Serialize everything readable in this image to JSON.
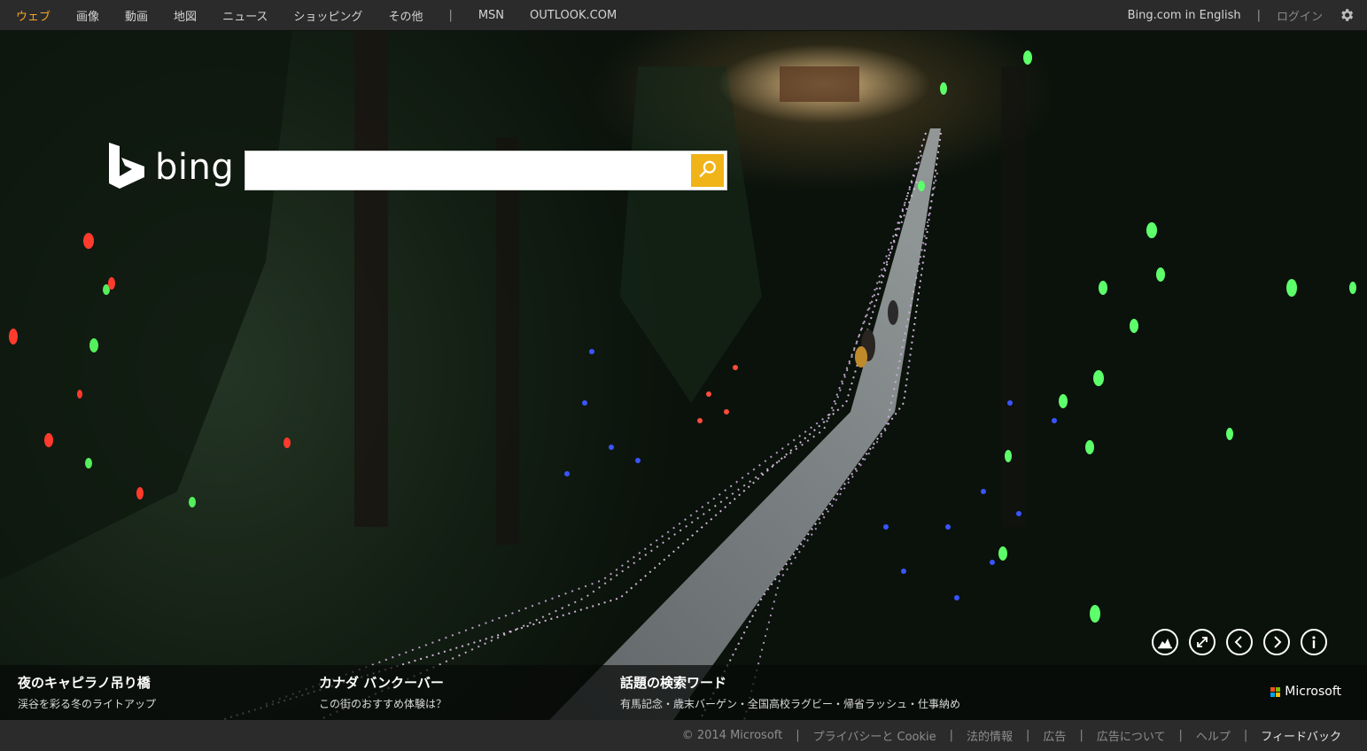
{
  "topnav": {
    "items": [
      {
        "label": "ウェブ",
        "active": true
      },
      {
        "label": "画像",
        "active": false
      },
      {
        "label": "動画",
        "active": false
      },
      {
        "label": "地図",
        "active": false
      },
      {
        "label": "ニュース",
        "active": false
      },
      {
        "label": "ショッピング",
        "active": false
      },
      {
        "label": "その他",
        "active": false
      }
    ],
    "separator": "|",
    "extra_links": [
      "MSN",
      "OUTLOOK.COM"
    ],
    "right": {
      "english_link": "Bing.com in English",
      "separator": "|",
      "login": "ログイン",
      "settings_icon": "gear-icon"
    }
  },
  "logo": {
    "word": "bing",
    "icon": "bing-b-icon"
  },
  "search": {
    "value": "",
    "placeholder": "",
    "button_icon": "search-icon",
    "button_color": "#f0b418"
  },
  "controls": [
    "map-pin-icon",
    "fullscreen-icon",
    "previous-icon",
    "next-icon",
    "info-icon"
  ],
  "captions": [
    {
      "title": "夜のキャピラノ吊り橋",
      "subtitle": "渓谷を彩る冬のライトアップ"
    },
    {
      "title": "カナダ バンクーバー",
      "subtitle": "この街のおすすめ体験は？"
    },
    {
      "title": "話題の検索ワード",
      "subtitle": "有馬記念・歳末バーゲン・全国高校ラグビー・帰省ラッシュ・仕事納め"
    }
  ],
  "brand": {
    "name": "Microsoft",
    "logo_colors": [
      "#f25022",
      "#7fba00",
      "#00a4ef",
      "#ffb900"
    ]
  },
  "footer": {
    "copyright": "© 2014 Microsoft",
    "links": [
      "プライバシーと Cookie",
      "法的情報",
      "広告",
      "広告について",
      "ヘルプ",
      "フィードバック"
    ],
    "separator": "|"
  },
  "colors": {
    "active_nav": "#f5a623",
    "bar_bg": "#2b2b2b"
  }
}
